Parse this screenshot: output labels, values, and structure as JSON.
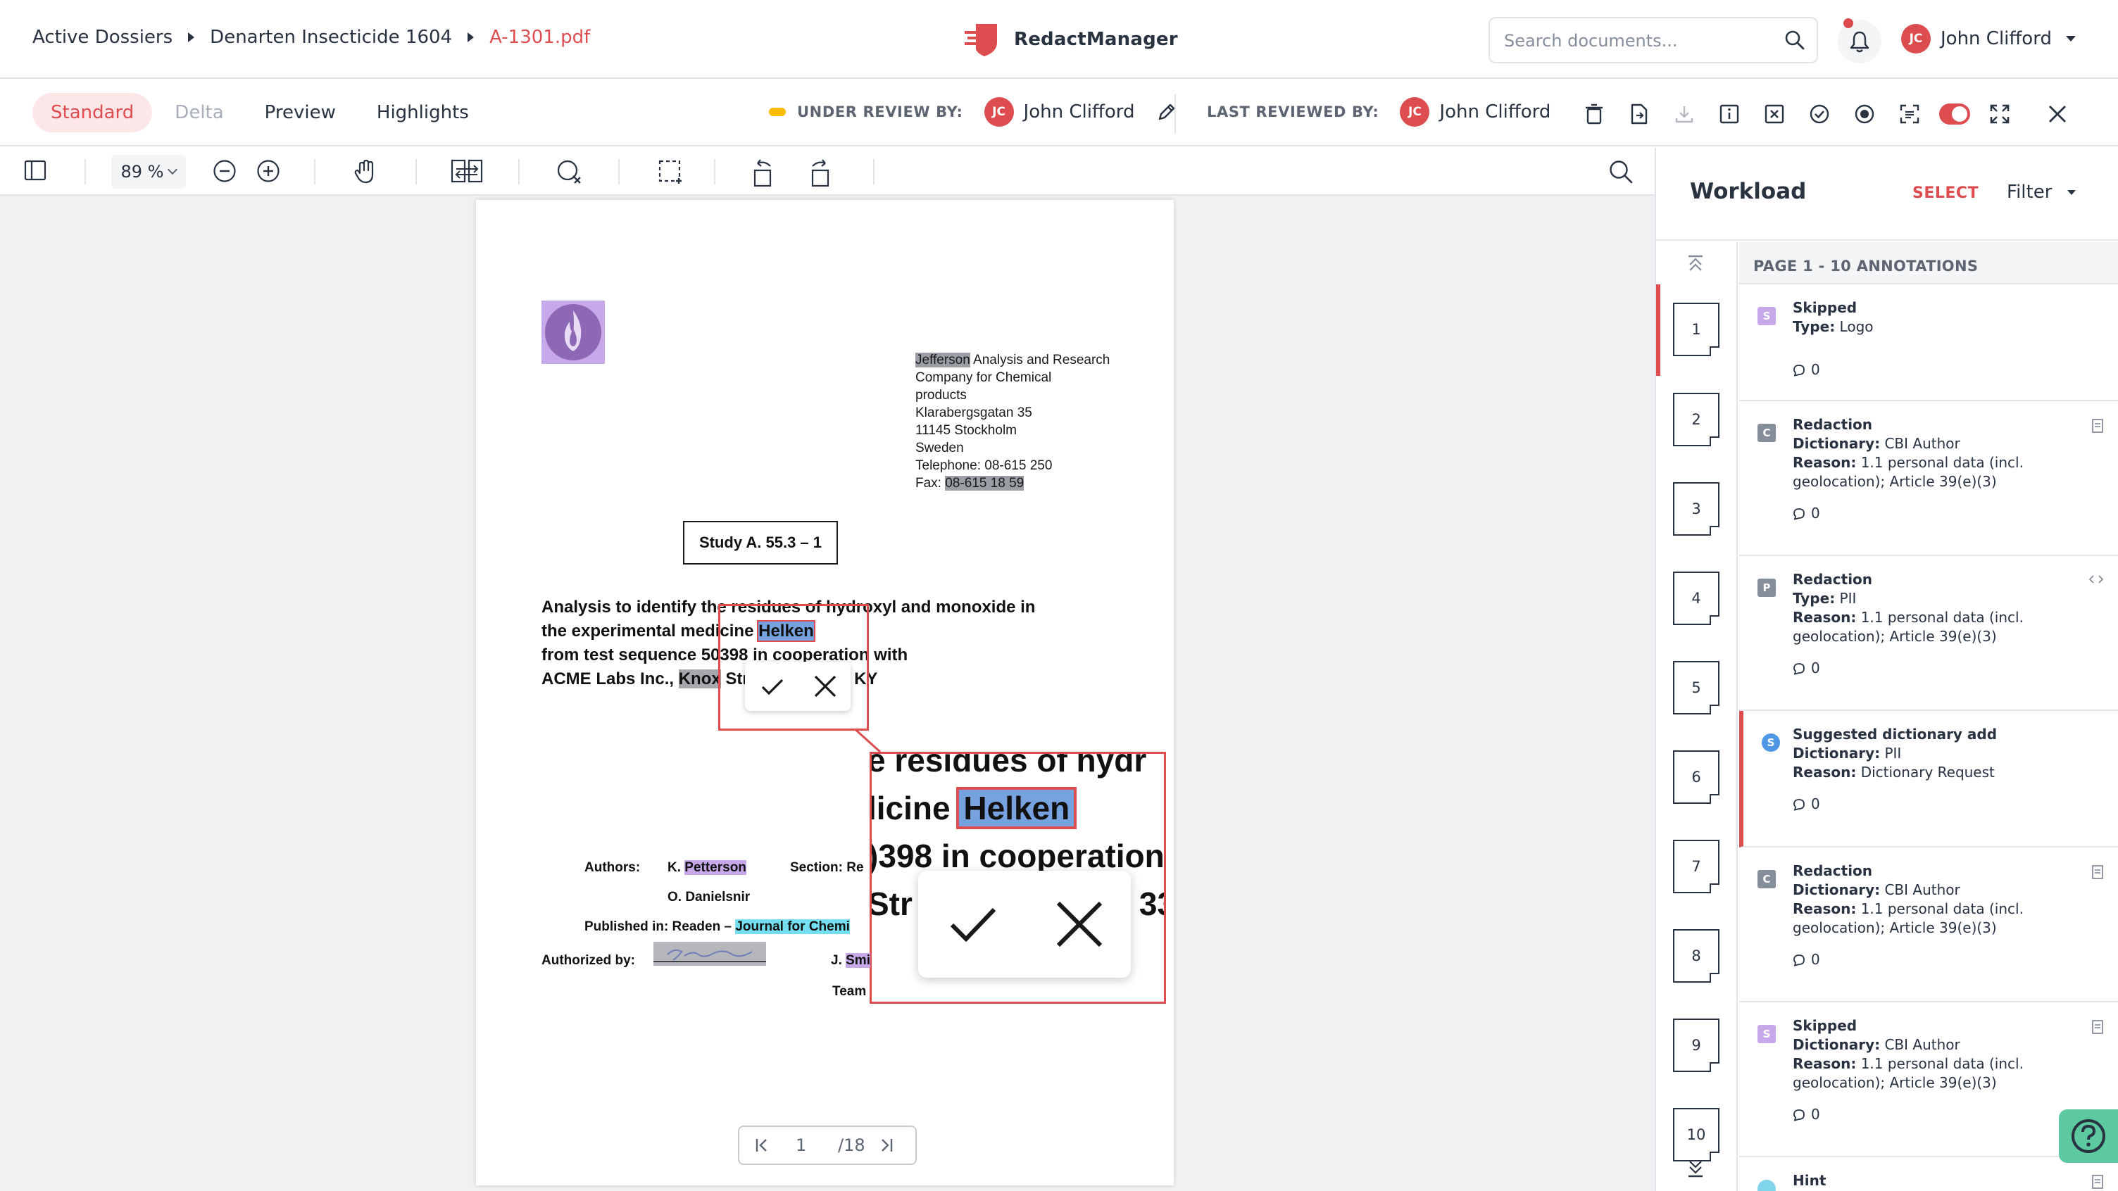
{
  "breadcrumb": {
    "items": [
      "Active Dossiers",
      "Denarten Insecticide 1604",
      "A-1301.pdf"
    ]
  },
  "app": {
    "name": "RedactManager"
  },
  "search": {
    "placeholder": "Search documents..."
  },
  "user": {
    "initials": "JC",
    "name": "John Clifford"
  },
  "view_tabs": [
    {
      "label": "Standard",
      "state": "active"
    },
    {
      "label": "Delta",
      "state": "disabled"
    },
    {
      "label": "Preview",
      "state": "normal"
    },
    {
      "label": "Highlights",
      "state": "normal"
    }
  ],
  "review": {
    "under_review_label": "UNDER REVIEW BY:",
    "under_review_initials": "JC",
    "under_review_name": "John Clifford",
    "last_reviewed_label": "LAST REVIEWED BY:",
    "last_reviewed_initials": "JC",
    "last_reviewed_name": "John Clifford"
  },
  "viewer_toolbar": {
    "zoom": "89 %"
  },
  "document": {
    "address": {
      "company_highlight": "Jefferson",
      "line1_rest": " Analysis and Research",
      "line2": "Company for Chemical",
      "line3": "products",
      "line4": "Klarabergsgatan 35",
      "line5": "11145 Stockholm",
      "line6": "Sweden",
      "telephone": "Telephone: 08-615 250",
      "fax_label": "Fax: ",
      "fax_value": "08-615 18 59"
    },
    "study": "Study A. 55.3 – 1",
    "title": {
      "line1": "Analysis to identify the residues of hydroxyl and monoxide in",
      "line2_pre": "the experimental medicine ",
      "line2_hl": "Helken",
      "line3": "from test sequence 50398 in cooperation with",
      "line4_pre": "ACME Labs Inc., ",
      "line4_hl": "Knox",
      "line4_mid": " Str",
      "line4_end": "337, KY"
    },
    "magnifier": {
      "line1": "e residues of hydr",
      "line2_pre": "licine ",
      "line2_hl": "Helken",
      "line3": ")398 in cooperation",
      "line4_pre": "Str",
      "line4_end": "33"
    },
    "authors_label": "Authors:",
    "author1_initial": "K. ",
    "author1_hl": "Petterson",
    "author2": "O. Danielsnir",
    "section_label": "Section: Re",
    "published_label": "Published in: Readen – ",
    "published_hl": "Journal for Chemi",
    "authorized_label": "Authorized by:",
    "signer_initial": "J. ",
    "signer_hl": "Smi",
    "team": "Team"
  },
  "page_nav": {
    "current": "1",
    "total": "/18"
  },
  "workload": {
    "title": "Workload",
    "select": "SELECT",
    "filter": "Filter",
    "header": "PAGE 1 - 10 ANNOTATIONS",
    "pages": [
      "1",
      "2",
      "3",
      "4",
      "5",
      "6",
      "7",
      "8",
      "9",
      "10"
    ],
    "annotations": [
      {
        "badge": "S",
        "kind": "skip",
        "title": "Skipped",
        "f1_label": "Type:",
        "f1_value": " Logo",
        "comments": "0"
      },
      {
        "badge": "C",
        "kind": "red",
        "title": "Redaction",
        "f1_label": "Dictionary:",
        "f1_value": " CBI Author",
        "f2_label": "Reason:",
        "f2_value": " 1.1 personal data (incl. geolocation); Article 39(e)(3)",
        "comments": "0"
      },
      {
        "badge": "P",
        "kind": "red",
        "title": "Redaction",
        "f1_label": "Type:",
        "f1_value": " PII",
        "f2_label": "Reason:",
        "f2_value": " 1.1 personal data (incl. geolocation); Article 39(e)(3)",
        "comments": "0"
      },
      {
        "badge": "S",
        "kind": "sugg",
        "title": "Suggested dictionary add",
        "f1_label": "Dictionary:",
        "f1_value": " PII",
        "f2_label": "Reason:",
        "f2_value": " Dictionary Request",
        "comments": "0"
      },
      {
        "badge": "C",
        "kind": "red",
        "title": "Redaction",
        "f1_label": "Dictionary:",
        "f1_value": " CBI Author",
        "f2_label": "Reason:",
        "f2_value": " 1.1 personal data (incl. geolocation); Article 39(e)(3)",
        "comments": "0"
      },
      {
        "badge": "S",
        "kind": "skip",
        "title": "Skipped",
        "f1_label": "Dictionary:",
        "f1_value": " CBI Author",
        "f2_label": "Reason:",
        "f2_value": " 1.1 personal data (incl. geolocation); Article 39(e)(3)",
        "comments": "0"
      },
      {
        "title": "Hint"
      }
    ]
  },
  "colors": {
    "accent": "#dd4d50",
    "status_under_review": "#fdbd00",
    "highlight_blue": "#76a3df",
    "highlight_purple": "#c7a9ea",
    "highlight_cyan": "#74dff0",
    "help_button": "#5cc9a0"
  },
  "icons": [
    "caret-right-icon",
    "redactmanager-logo-icon",
    "search-icon",
    "bell-icon",
    "chevron-down-icon",
    "pencil-icon",
    "trash-icon",
    "file-icon",
    "download-icon",
    "info-icon",
    "excel-icon",
    "check-circle-icon",
    "record-icon",
    "scan-icon",
    "toggle-icon",
    "fullscreen-icon",
    "close-icon",
    "sidebar-toggle-icon",
    "zoom-out-icon",
    "zoom-in-icon",
    "pan-hand-icon",
    "compare-icon",
    "search-cancel-icon",
    "area-select-icon",
    "rotate-left-icon",
    "rotate-right-icon",
    "checkmark-icon",
    "reject-x-icon",
    "first-page-icon",
    "last-page-icon",
    "scroll-top-icon",
    "scroll-bottom-icon",
    "comment-icon",
    "help-icon"
  ]
}
